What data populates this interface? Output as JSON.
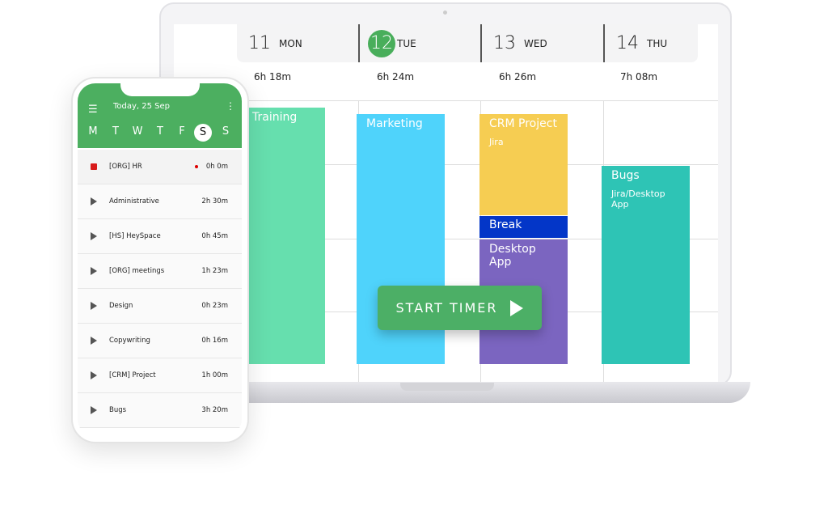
{
  "laptop": {
    "days": [
      {
        "num": "11",
        "name": "MON",
        "total": "6h 18m"
      },
      {
        "num": "12",
        "name": "TUE",
        "total": "6h 24m",
        "today": true
      },
      {
        "num": "13",
        "name": "WED",
        "total": "6h 26m"
      },
      {
        "num": "14",
        "name": "THU",
        "total": "7h 08m"
      }
    ],
    "events": {
      "training": "Training",
      "marketing": "Marketing",
      "crm": "CRM Project",
      "crm_sub": "Jira",
      "break": "Break",
      "desktop": "Desktop App",
      "bugs": "Bugs",
      "bugs_sub": "Jira/Desktop App"
    },
    "start_timer": "START TIMER",
    "colors": {
      "accent": "#4caf66",
      "training": "#66dfae",
      "marketing": "#4fd3fb",
      "crm": "#f6cd52",
      "break": "#0336c8",
      "desktop": "#7b65c0",
      "bugs": "#2ec4b5"
    }
  },
  "phone": {
    "title": "Today, 25 Sep",
    "weekdays": [
      "M",
      "T",
      "W",
      "T",
      "F",
      "S",
      "S"
    ],
    "selected_day_index": 5,
    "entries": [
      {
        "label": "[ORG] HR",
        "time": "0h 0m",
        "running": true
      },
      {
        "label": "Administrative",
        "time": "2h 30m"
      },
      {
        "label": "[HS] HeySpace",
        "time": "0h 45m"
      },
      {
        "label": "[ORG] meetings",
        "time": "1h 23m"
      },
      {
        "label": "Design",
        "time": "0h 23m"
      },
      {
        "label": "Copywriting",
        "time": "0h 16m"
      },
      {
        "label": "[CRM] Project",
        "time": "1h 00m"
      },
      {
        "label": "Bugs",
        "time": "3h 20m"
      }
    ]
  }
}
